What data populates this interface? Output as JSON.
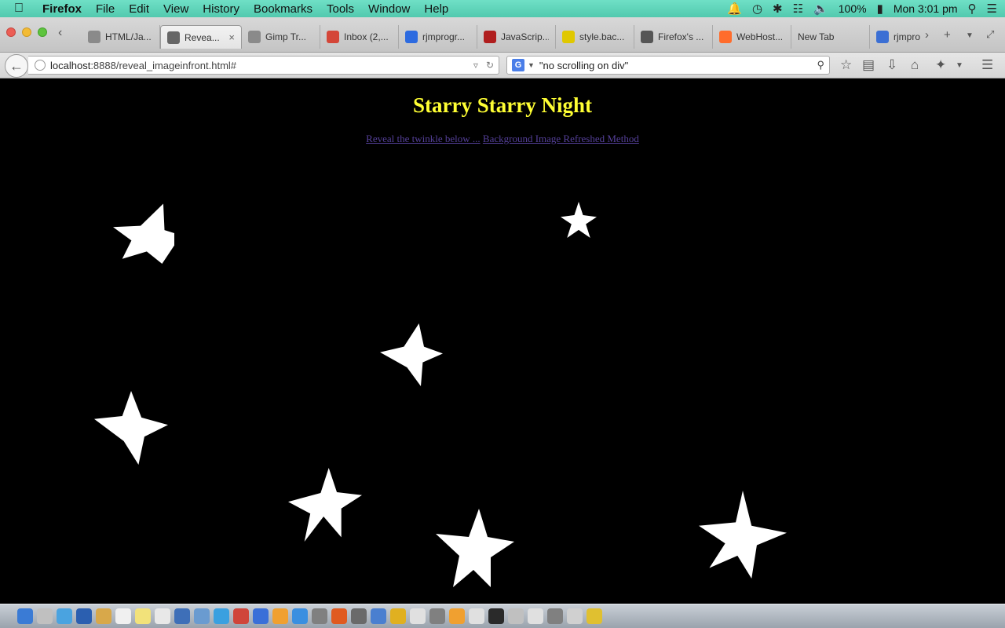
{
  "menubar": {
    "app": "Firefox",
    "items": [
      "File",
      "Edit",
      "View",
      "History",
      "Bookmarks",
      "Tools",
      "Window",
      "Help"
    ],
    "battery": "100%",
    "clock": "Mon 3:01 pm"
  },
  "tabs": [
    {
      "label": "HTML/Ja...",
      "favicon": "image-icon",
      "color": "#8a8a8a"
    },
    {
      "label": "Revea...",
      "favicon": "globe-icon",
      "color": "#666666",
      "active": true
    },
    {
      "label": "Gimp Tr...",
      "favicon": "image-icon",
      "color": "#8a8a8a"
    },
    {
      "label": "Inbox (2,...",
      "favicon": "gmail-icon",
      "color": "#d44638"
    },
    {
      "label": "rjmprogr...",
      "favicon": "a-icon",
      "color": "#2d6be0"
    },
    {
      "label": "JavaScrip...",
      "favicon": "c-icon",
      "color": "#b01e1e"
    },
    {
      "label": "style.bac...",
      "favicon": "wd-icon",
      "color": "#e0c800"
    },
    {
      "label": "Firefox's ...",
      "favicon": "zine-icon",
      "color": "#555555"
    },
    {
      "label": "WebHost...",
      "favicon": "cp-icon",
      "color": "#ff6c2c"
    },
    {
      "label": "New Tab",
      "favicon": "",
      "color": ""
    },
    {
      "label": "rjmpro",
      "favicon": "g-icon",
      "color": "#3b6fd4"
    }
  ],
  "navbar": {
    "url_host": "localhost",
    "url_path": ":8888/reveal_imageinfront.html#",
    "search_value": "\"no scrolling on div\"",
    "search_engine": "G"
  },
  "page": {
    "title": "Starry Starry Night",
    "link1": "Reveal the twinkle below ...",
    "link_separator": " ",
    "link2": "Background Image Refreshed Method",
    "title_color": "#ffff33",
    "link_color": "#55409a"
  },
  "dock": {
    "icon_colors": [
      "#3a7bd5",
      "#c0c0c0",
      "#4aa3e0",
      "#2b5fb0",
      "#d8a84a",
      "#f0f0f0",
      "#f2e27a",
      "#e8e8e8",
      "#3e6fb8",
      "#6a9bd0",
      "#3aa0e0",
      "#d0453a",
      "#3a6fd8",
      "#f0a030",
      "#3a8fe0",
      "#808080",
      "#e05a20",
      "#6a6a6a",
      "#4a7fd0",
      "#e0b020",
      "#e0e0e0",
      "#808080",
      "#f0a030",
      "#e0e0e0",
      "#2a2a2a",
      "#c0c0c0",
      "#e0e0e0",
      "#808080",
      "#d0d0d0",
      "#e0c030"
    ]
  }
}
